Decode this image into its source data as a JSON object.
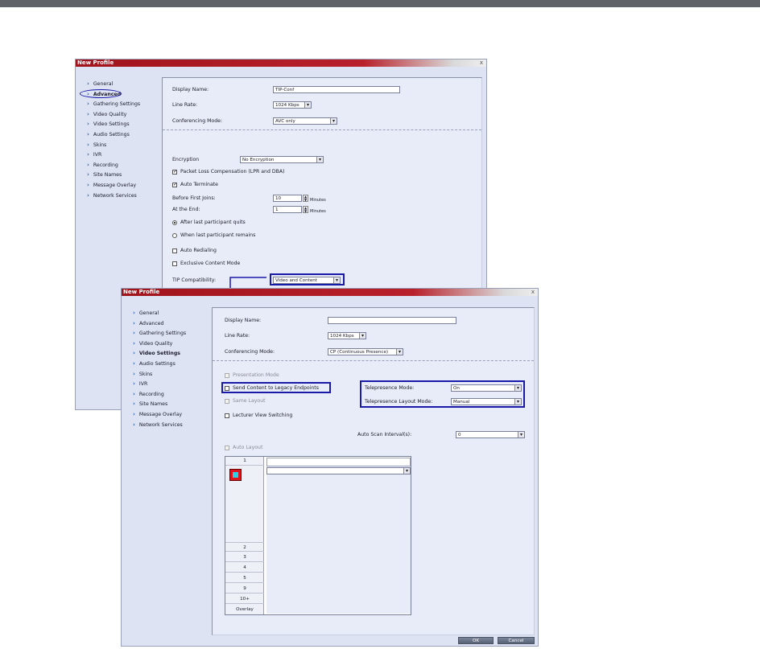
{
  "window1": {
    "title": "New Profile",
    "close": "x",
    "sidebar": [
      {
        "label": "General",
        "bold": false,
        "circled": false
      },
      {
        "label": "Advanced",
        "bold": true,
        "circled": true
      },
      {
        "label": "Gathering Settings",
        "bold": false,
        "circled": false
      },
      {
        "label": "Video Quality",
        "bold": false,
        "circled": false
      },
      {
        "label": "Video Settings",
        "bold": false,
        "circled": false
      },
      {
        "label": "Audio Settings",
        "bold": false,
        "circled": false
      },
      {
        "label": "Skins",
        "bold": false,
        "circled": false
      },
      {
        "label": "IVR",
        "bold": false,
        "circled": false
      },
      {
        "label": "Recording",
        "bold": false,
        "circled": false
      },
      {
        "label": "Site Names",
        "bold": false,
        "circled": false
      },
      {
        "label": "Message Overlay",
        "bold": false,
        "circled": false
      },
      {
        "label": "Network Services",
        "bold": false,
        "circled": false
      }
    ],
    "display_name_label": "Display Name:",
    "display_name_value": "TIP-Conf",
    "line_rate_label": "Line Rate:",
    "line_rate_value": "1024 Kbps",
    "conf_mode_label": "Conferencing Mode:",
    "conf_mode_value": "AVC only",
    "encryption_label": "Encryption",
    "encryption_value": "No Encryption",
    "plc_label": "Packet Loss Compensation (LPR and DBA)",
    "auto_terminate_label": "Auto Terminate",
    "before_first_label": "Before First Joins:",
    "before_first_value": "10",
    "at_end_label": "At the End:",
    "at_end_value": "1",
    "minutes": "Minutes",
    "radio1_label": "After last participant quits",
    "radio2_label": "When last participant remains",
    "auto_redial_label": "Auto Redialing",
    "exclusive_label": "Exclusive Content Mode",
    "tip_label": "TIP Compatibility:",
    "tip_value": "Video and Content"
  },
  "window2": {
    "title": "New Profile",
    "close": "x",
    "sidebar": [
      {
        "label": "General",
        "bold": false
      },
      {
        "label": "Advanced",
        "bold": false
      },
      {
        "label": "Gathering Settings",
        "bold": false
      },
      {
        "label": "Video Quality",
        "bold": false
      },
      {
        "label": "Video Settings",
        "bold": true
      },
      {
        "label": "Audio Settings",
        "bold": false
      },
      {
        "label": "Skins",
        "bold": false
      },
      {
        "label": "IVR",
        "bold": false
      },
      {
        "label": "Recording",
        "bold": false
      },
      {
        "label": "Site Names",
        "bold": false
      },
      {
        "label": "Message Overlay",
        "bold": false
      },
      {
        "label": "Network Services",
        "bold": false
      }
    ],
    "display_name_label": "Display Name:",
    "display_name_value": "",
    "line_rate_label": "Line Rate:",
    "line_rate_value": "1024 Kbps",
    "conf_mode_label": "Conferencing Mode:",
    "conf_mode_value": "CP (Continuous Presence)",
    "presentation_label": "Presentation Mode",
    "send_content_label": "Send Content to Legacy Endpoints",
    "same_layout_label": "Same Layout",
    "lecturer_label": "Lecturer View Switching",
    "tele_mode_label": "Telepresence Mode:",
    "tele_mode_value": "On",
    "tele_layout_label": "Telepresence Layout Mode:",
    "tele_layout_value": "Manual",
    "auto_scan_label": "Auto Scan Interval(s):",
    "auto_scan_value": "0",
    "auto_layout_label": "Auto Layout",
    "layout_numbers": [
      "1",
      "2",
      "3",
      "4",
      "5",
      "9",
      "10+",
      "Overlay"
    ],
    "ok_label": "OK",
    "cancel_label": "Cancel"
  },
  "colors": {
    "highlight": "#1a1aa8",
    "titlebar": "#a0141c",
    "layout_red": "#e0141c",
    "layout_cyan": "#2ad0e8"
  }
}
